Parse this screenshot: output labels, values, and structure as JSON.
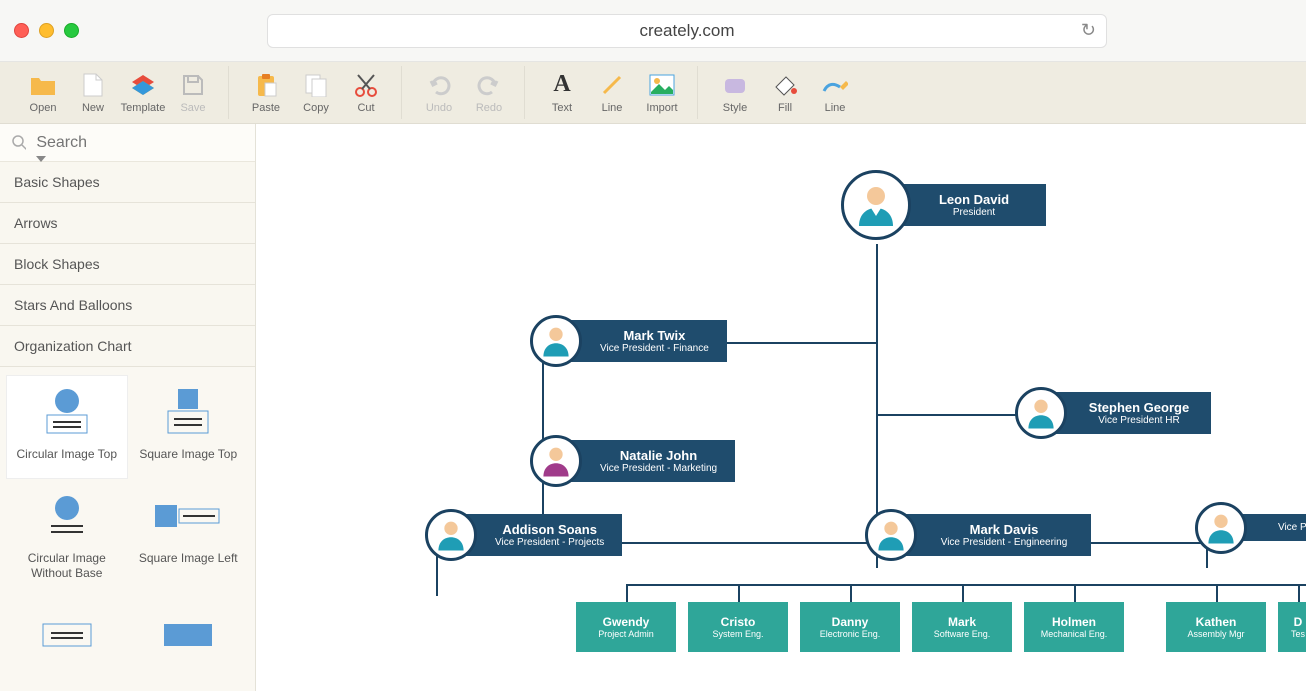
{
  "browser": {
    "url": "creately.com"
  },
  "toolbar": {
    "open": "Open",
    "new": "New",
    "template": "Template",
    "save": "Save",
    "paste": "Paste",
    "copy": "Copy",
    "cut": "Cut",
    "undo": "Undo",
    "redo": "Redo",
    "text": "Text",
    "line": "Line",
    "import": "Import",
    "style": "Style",
    "fill": "Fill",
    "line2": "Line"
  },
  "search": {
    "placeholder": "Search"
  },
  "panels": {
    "basic": "Basic Shapes",
    "arrows": "Arrows",
    "block": "Block Shapes",
    "stars": "Stars And Balloons",
    "org": "Organization Chart"
  },
  "shapes": {
    "circTop": "Circular Image Top",
    "sqTop": "Square Image Top",
    "circNoBase": "Circular Image Without Base",
    "sqLeft": "Square Image Left"
  },
  "chart_data": {
    "type": "tree",
    "nodes": [
      {
        "id": "pres",
        "name": "Leon David",
        "role": "President"
      },
      {
        "id": "vpfin",
        "name": "Mark Twix",
        "role": "Vice President - Finance"
      },
      {
        "id": "vphr",
        "name": "Stephen George",
        "role": "Vice President HR"
      },
      {
        "id": "vpmkt",
        "name": "Natalie John",
        "role": "Vice President - Marketing"
      },
      {
        "id": "vpproj",
        "name": "Addison Soans",
        "role": "Vice President - Projects"
      },
      {
        "id": "vpeng",
        "name": "Mark Davis",
        "role": "Vice President - Engineering"
      },
      {
        "id": "vpx",
        "name": "",
        "role": "Vice Pr"
      },
      {
        "id": "l1",
        "name": "Gwendy",
        "role": "Project Admin"
      },
      {
        "id": "l2",
        "name": "Cristo",
        "role": "System Eng."
      },
      {
        "id": "l3",
        "name": "Danny",
        "role": "Electronic Eng."
      },
      {
        "id": "l4",
        "name": "Mark",
        "role": "Software Eng."
      },
      {
        "id": "l5",
        "name": "Holmen",
        "role": "Mechanical Eng."
      },
      {
        "id": "l6",
        "name": "Kathen",
        "role": "Assembly Mgr"
      },
      {
        "id": "l7",
        "name": "D",
        "role": "Tes"
      }
    ]
  },
  "colors": {
    "darkblue": "#1f4c6d",
    "border": "#1b4261",
    "teal": "#2fa699"
  }
}
